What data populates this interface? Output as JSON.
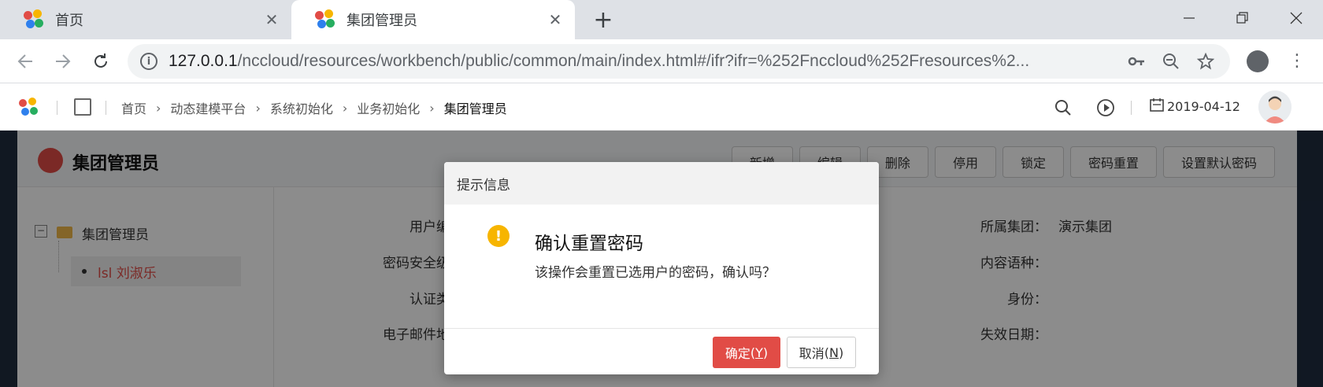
{
  "browser": {
    "tabs": [
      {
        "title": "首页"
      },
      {
        "title": "集团管理员"
      }
    ],
    "url_host": "127.0.0.1",
    "url_rest": "/nccloud/resources/workbench/public/common/main/index.html#/ifr?ifr=%252Fnccloud%252Fresources%2...",
    "close_glyph": "✕",
    "newtab_glyph": "+"
  },
  "app": {
    "breadcrumb": [
      "首页",
      "动态建模平台",
      "系统初始化",
      "业务初始化",
      "集团管理员"
    ],
    "date": "2019-04-12"
  },
  "card": {
    "title": "集团管理员",
    "buttons": [
      "新增",
      "编辑",
      "删除",
      "停用",
      "锁定",
      "密码重置",
      "设置默认密码"
    ]
  },
  "tree": {
    "root": "集团管理员",
    "leaf": "lsl 刘淑乐"
  },
  "form": {
    "left_labels": [
      "用户编码",
      "密码安全级别",
      "认证类型",
      "电子邮件地址"
    ],
    "right_labels": [
      "所属集团",
      "内容语种",
      "身份",
      "失效日期"
    ],
    "right_values": [
      "演示集团",
      "",
      "",
      ""
    ],
    "colon": "："
  },
  "modal": {
    "header": "提示信息",
    "title": "确认重置密码",
    "message": "该操作会重置已选用户的密码，确认吗？",
    "ok_label": "确定",
    "ok_key": "Y",
    "cancel_label": "取消",
    "cancel_key": "N"
  },
  "colors": {
    "accent": "#e14c46",
    "warning": "#f7b500"
  }
}
